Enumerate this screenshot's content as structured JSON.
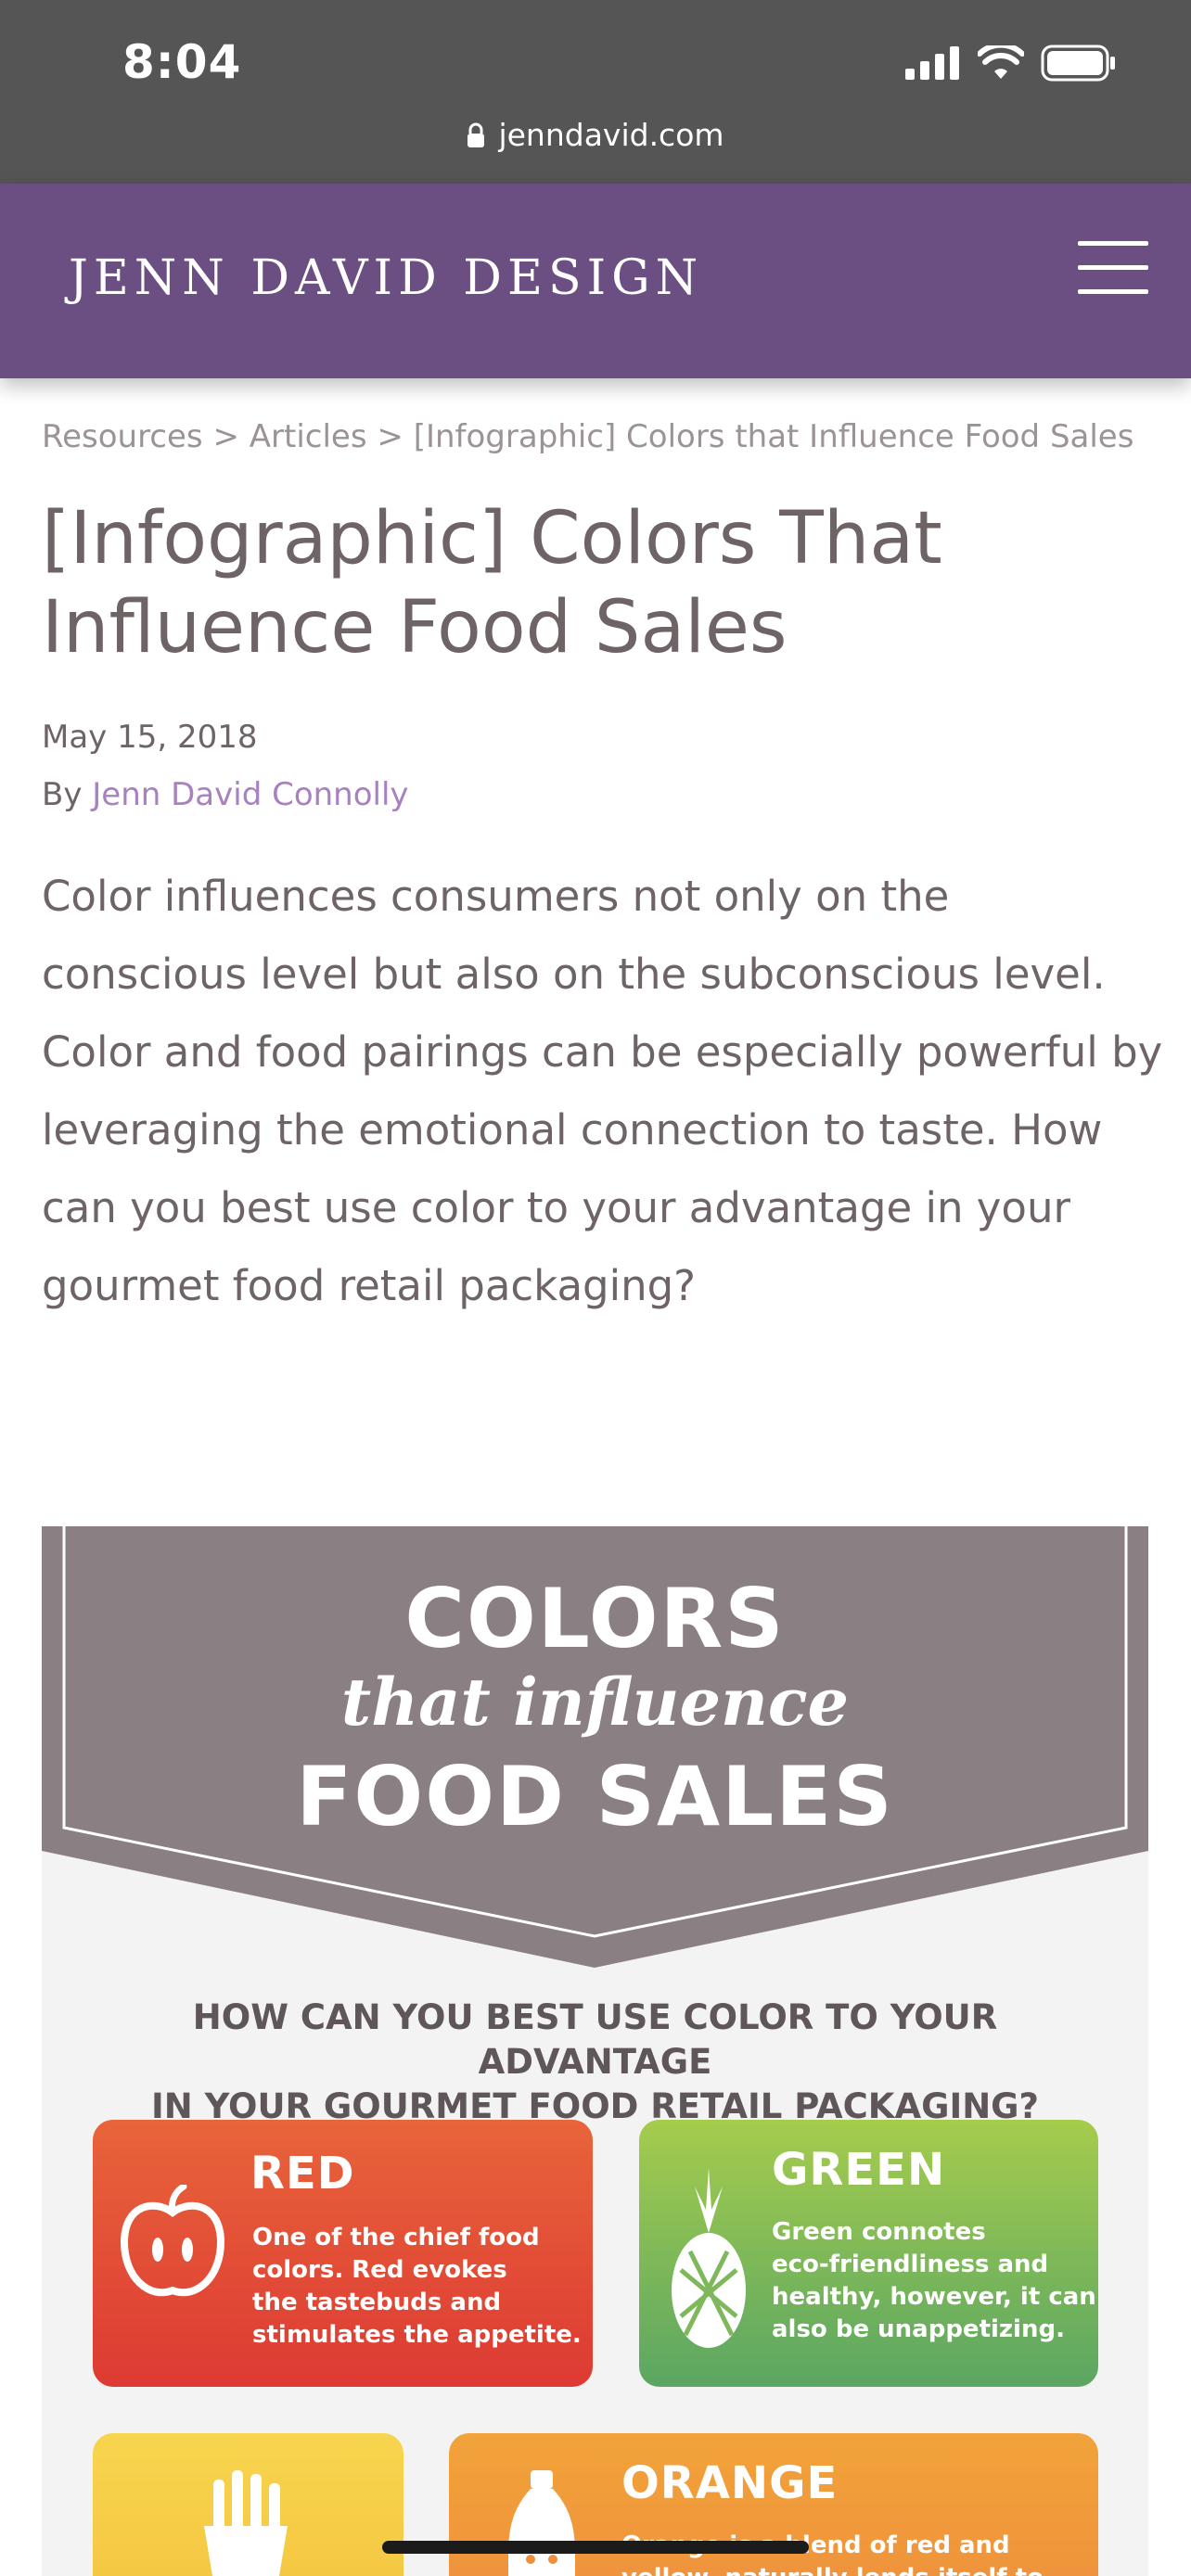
{
  "status_bar": {
    "time": "8:04",
    "url": "jenndavid.com"
  },
  "header": {
    "logo": "JENN DAVID DESIGN"
  },
  "breadcrumb": {
    "items": [
      "Resources",
      "Articles",
      "[Infographic] Colors that Influence Food Sales"
    ],
    "separator": ">"
  },
  "article": {
    "title": "[Infographic] Colors That Influence Food Sales",
    "date": "May 15, 2018",
    "by_prefix": "By",
    "author": "Jenn David Connolly",
    "intro": "Color influences consumers not only on the conscious level but also on the subconscious level. Color and food pairings can be especially powerful by leveraging the emotional connection to taste. How can you best use color to your advantage in your gourmet food retail packaging?"
  },
  "infographic": {
    "title_line1": "COLORS",
    "title_line2": "that influence",
    "title_line3": "FOOD SALES",
    "question_line1": "HOW CAN YOU BEST USE COLOR TO YOUR ADVANTAGE",
    "question_line2": "IN YOUR GOURMET FOOD RETAIL PACKAGING?",
    "cards": {
      "red": {
        "heading": "RED",
        "body": [
          "One of the chief food",
          "colors. Red evokes",
          "the tastebuds and",
          "stimulates the appetite."
        ],
        "icon": "apple-icon",
        "color": "#dd3a33"
      },
      "green": {
        "heading": "GREEN",
        "body": [
          "Green connotes",
          "eco-friendliness and",
          "healthy, however, it can",
          "also be unappetizing."
        ],
        "icon": "pineapple-icon",
        "color": "#5ba663"
      },
      "yellow": {
        "icon": "fries-icon",
        "color": "#f4c43f"
      },
      "orange": {
        "heading": "ORANGE",
        "body": [
          "Orange is a blend of red and",
          "yellow, naturally lends itself to"
        ],
        "icon": "bottle-icon",
        "color": "#ee8f3c"
      }
    }
  },
  "colors": {
    "header_purple": "#6c4f82",
    "author_link": "#a980c0",
    "body_text": "#6e6466",
    "banner": "#8a8084"
  }
}
